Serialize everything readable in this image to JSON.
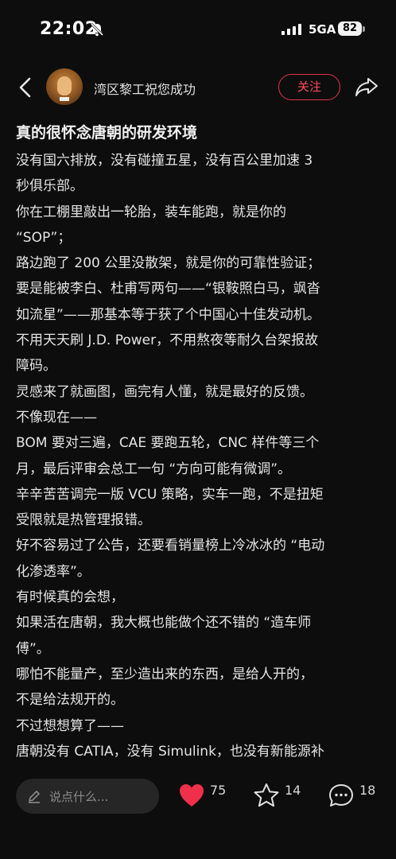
{
  "status_bar": {
    "time": "22:02",
    "network": "5GA",
    "battery": "82"
  },
  "header": {
    "author": "湾区黎工祝您成功",
    "follow_label": "关注"
  },
  "article": {
    "title": "真的很怀念唐朝的研发环境",
    "lines": [
      "没有国六排放，没有碰撞五星，没有百公里加速 3",
      "秒俱乐部。",
      "你在工棚里敲出一轮胎，装车能跑，就是你的",
      "“SOP”；",
      "路边跑了 200 公里没散架，就是你的可靠性验证；",
      "要是能被李白、杜甫写两句——“银鞍照白马，飒沓",
      "如流星”——那基本等于获了个中国心十佳发动机。",
      "不用天天刷 J.D. Power，不用熬夜等耐久台架报故",
      "障码。",
      "灵感来了就画图，画完有人懂，就是最好的反馈。",
      "不像现在——",
      "BOM 要对三遍，CAE 要跑五轮，CNC 样件等三个",
      "月，最后评审会总工一句 “方向可能有微调”。",
      "辛辛苦苦调完一版 VCU 策略，实车一跑，不是扭矩",
      "受限就是热管理报错。",
      "好不容易过了公告，还要看销量榜上冷冰冰的 “电动",
      "化渗透率”。",
      "有时候真的会想，",
      "如果活在唐朝，我大概也能做个还不错的 “造车师",
      "傅”。",
      "哪怕不能量产，至少造出来的东西，是给人开的，",
      "不是给法规开的。",
      "不过想想算了——",
      "唐朝没有 CATIA，没有 Simulink，也没有新能源补"
    ]
  },
  "bottom_bar": {
    "comment_placeholder": "说点什么...",
    "likes": "75",
    "favorites": "14",
    "comments": "18"
  },
  "colors": {
    "accent": "#ff4a5e",
    "like": "#f0304a",
    "background": "#0d0d0d"
  },
  "icons": [
    "mute-bell-icon",
    "signal-icon",
    "back-arrow-icon",
    "share-icon",
    "pen-icon",
    "heart-icon",
    "star-icon",
    "comment-icon"
  ]
}
